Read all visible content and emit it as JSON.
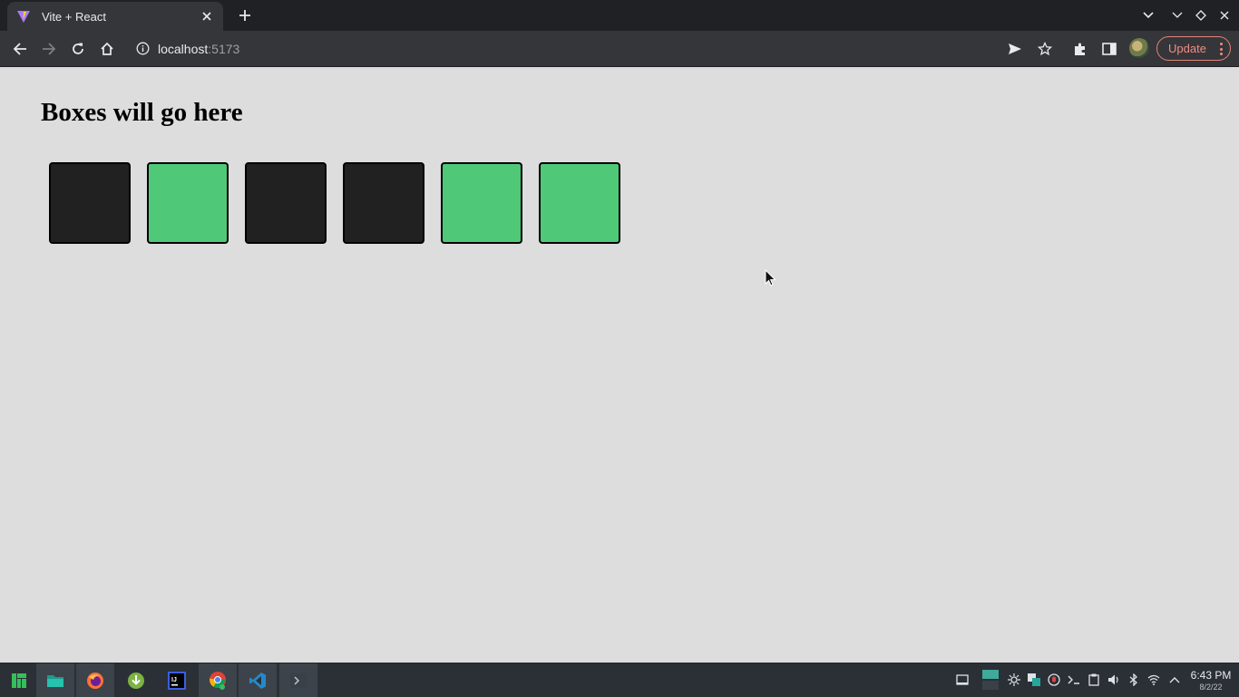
{
  "browser": {
    "tab": {
      "title": "Vite + React"
    },
    "address": {
      "host": "localhost",
      "port": ":5173"
    },
    "update_label": "Update"
  },
  "page": {
    "heading": "Boxes will go here",
    "boxes": [
      {
        "state": "dark",
        "color": "#212121"
      },
      {
        "state": "green",
        "color": "#4fc978"
      },
      {
        "state": "dark",
        "color": "#212121"
      },
      {
        "state": "dark",
        "color": "#212121"
      },
      {
        "state": "green",
        "color": "#4fc978"
      },
      {
        "state": "green",
        "color": "#4fc978"
      }
    ]
  },
  "taskbar": {
    "apps": [
      "manjaro-menu",
      "file-manager",
      "firefox",
      "download-manager",
      "intellij-idea",
      "chrome",
      "vscode",
      "terminal"
    ],
    "clock": {
      "time": "6:43 PM",
      "date": "8/2/22"
    }
  },
  "colors": {
    "page_bg": "#dddddd",
    "chrome_dark": "#202124",
    "chrome_toolbar": "#35363a",
    "update_accent": "#f28b82",
    "box_dark": "#212121",
    "box_green": "#4fc978"
  }
}
